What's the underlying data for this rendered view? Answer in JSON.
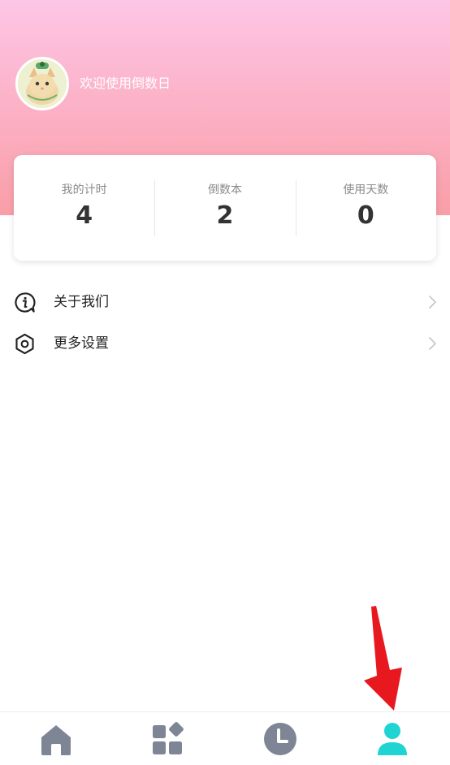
{
  "header": {
    "welcome_text": "欢迎使用倒数日"
  },
  "stats": [
    {
      "label": "我的计时",
      "value": "4"
    },
    {
      "label": "倒数本",
      "value": "2"
    },
    {
      "label": "使用天数",
      "value": "0"
    }
  ],
  "menu": [
    {
      "label": "关于我们",
      "icon": "info-icon"
    },
    {
      "label": "更多设置",
      "icon": "settings-hex-icon"
    }
  ],
  "bottom_nav": [
    {
      "icon": "home-icon",
      "active": false
    },
    {
      "icon": "apps-grid-icon",
      "active": false
    },
    {
      "icon": "clock-icon",
      "active": false
    },
    {
      "icon": "profile-icon",
      "active": true
    }
  ],
  "colors": {
    "nav_inactive": "#7e8594",
    "nav_active": "#1fd4d2",
    "annotation_arrow": "#e8181f",
    "header_gradient_top": "#fdc6e6",
    "header_gradient_bottom": "#f99ea7"
  }
}
